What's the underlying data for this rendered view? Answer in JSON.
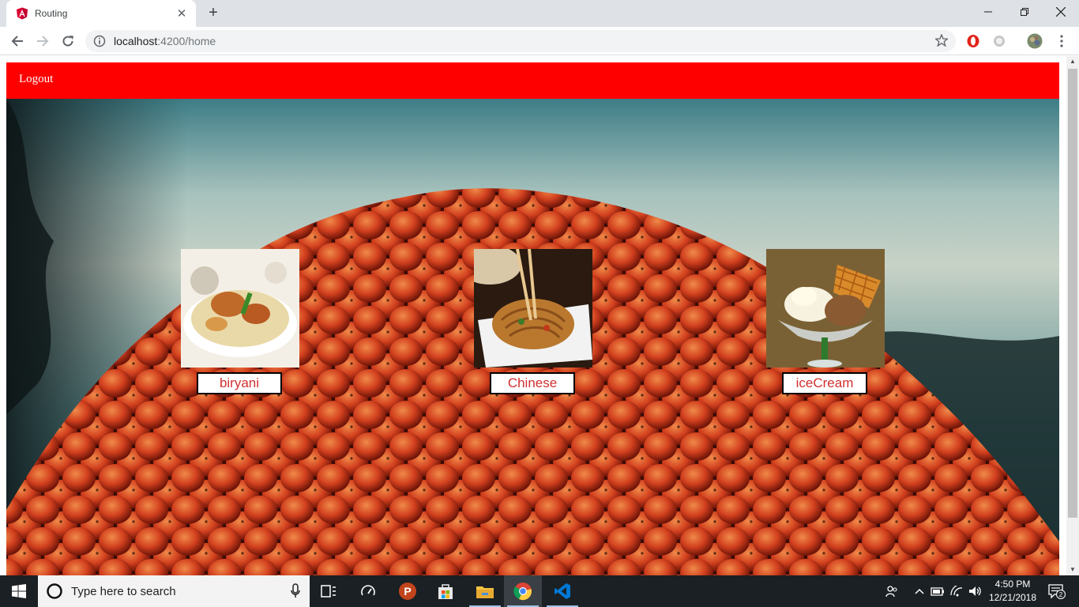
{
  "browser": {
    "tab_title": "Routing",
    "url_host": "localhost",
    "url_rest": ":4200/home",
    "favicon": "angular-icon",
    "accent": "#dd0031"
  },
  "app": {
    "navbar_color": "#ff0000",
    "logout_label": "Logout",
    "cards": [
      {
        "label": "biryani",
        "image": "biryani-photo"
      },
      {
        "label": "Chinese",
        "image": "chinese-noodles-photo"
      },
      {
        "label": "iceCream",
        "image": "ice-cream-photo"
      }
    ]
  },
  "taskbar": {
    "search_placeholder": "Type here to search",
    "time": "4:50 PM",
    "date": "12/21/2018",
    "notification_count": "2"
  }
}
